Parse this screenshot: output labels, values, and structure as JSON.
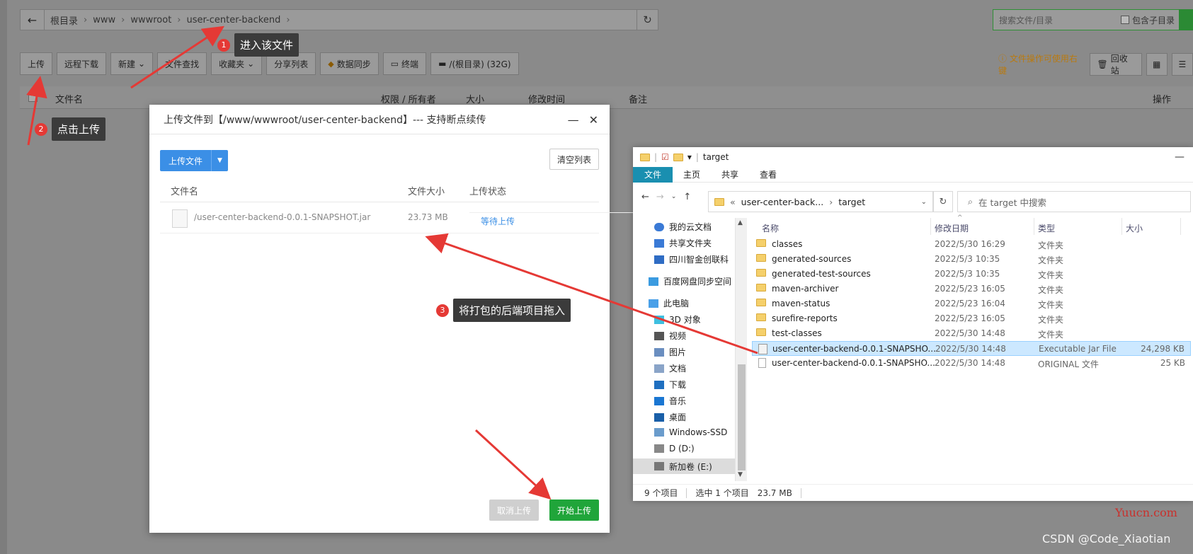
{
  "path_bar": {
    "crumbs": [
      "根目录",
      "www",
      "wwwroot",
      "user-center-backend"
    ],
    "search_placeholder": "搜索文件/目录",
    "include_subdir": "包含子目录"
  },
  "toolbar": {
    "buttons": [
      "上传",
      "远程下载",
      "新建",
      "文件查找",
      "收藏夹",
      "分享列表",
      "数据同步",
      "终端",
      "/(根目录) (32G)"
    ],
    "hint": "文件操作可使用右键",
    "recycle": "回收站"
  },
  "table_header": {
    "name": "文件名",
    "perm": "权限 / 所有者",
    "size": "大小",
    "mtime": "修改时间",
    "note": "备注",
    "ops": "操作"
  },
  "annotations": {
    "a1": {
      "num": "1",
      "text": "进入该文件"
    },
    "a2": {
      "num": "2",
      "text": "点击上传"
    },
    "a3": {
      "num": "3",
      "text": "将打包的后端项目拖入"
    }
  },
  "upload_dialog": {
    "title": "上传文件到【/www/wwwroot/user-center-backend】--- 支持断点续传",
    "upload_btn": "上传文件",
    "clear_btn": "清空列表",
    "col_name": "文件名",
    "col_size": "文件大小",
    "col_status": "上传状态",
    "file_name": "/user-center-backend-0.0.1-SNAPSHOT.jar",
    "file_size": "23.73 MB",
    "file_status": "等待上传",
    "cancel_btn": "取消上传",
    "start_btn": "开始上传"
  },
  "explorer": {
    "title": "target",
    "ribbon": [
      "文件",
      "主页",
      "共享",
      "查看"
    ],
    "address": [
      "user-center-back...",
      "target"
    ],
    "search_placeholder": "在 target 中搜索",
    "nav": [
      "我的云文档",
      "共享文件夹",
      "四川智金创联科",
      "百度网盘同步空间",
      "此电脑",
      "3D 对象",
      "视频",
      "图片",
      "文档",
      "下载",
      "音乐",
      "桌面",
      "Windows-SSD",
      "D (D:)",
      "新加卷 (E:)"
    ],
    "columns": [
      "名称",
      "修改日期",
      "类型",
      "大小"
    ],
    "files": [
      {
        "name": "classes",
        "date": "2022/5/30 16:29",
        "type": "文件夹",
        "size": ""
      },
      {
        "name": "generated-sources",
        "date": "2022/5/3 10:35",
        "type": "文件夹",
        "size": ""
      },
      {
        "name": "generated-test-sources",
        "date": "2022/5/3 10:35",
        "type": "文件夹",
        "size": ""
      },
      {
        "name": "maven-archiver",
        "date": "2022/5/23 16:05",
        "type": "文件夹",
        "size": ""
      },
      {
        "name": "maven-status",
        "date": "2022/5/23 16:04",
        "type": "文件夹",
        "size": ""
      },
      {
        "name": "surefire-reports",
        "date": "2022/5/23 16:05",
        "type": "文件夹",
        "size": ""
      },
      {
        "name": "test-classes",
        "date": "2022/5/30 14:48",
        "type": "文件夹",
        "size": ""
      },
      {
        "name": "user-center-backend-0.0.1-SNAPSHO...",
        "date": "2022/5/30 14:48",
        "type": "Executable Jar File",
        "size": "24,298 KB"
      },
      {
        "name": "user-center-backend-0.0.1-SNAPSHO...",
        "date": "2022/5/30 14:48",
        "type": "ORIGINAL 文件",
        "size": "25 KB"
      }
    ],
    "status": {
      "count": "9 个项目",
      "selected": "选中 1 个项目",
      "size": "23.7 MB"
    }
  },
  "watermarks": {
    "w1": "Yuucn.com",
    "w2": "CSDN @Code_Xiaotian"
  }
}
